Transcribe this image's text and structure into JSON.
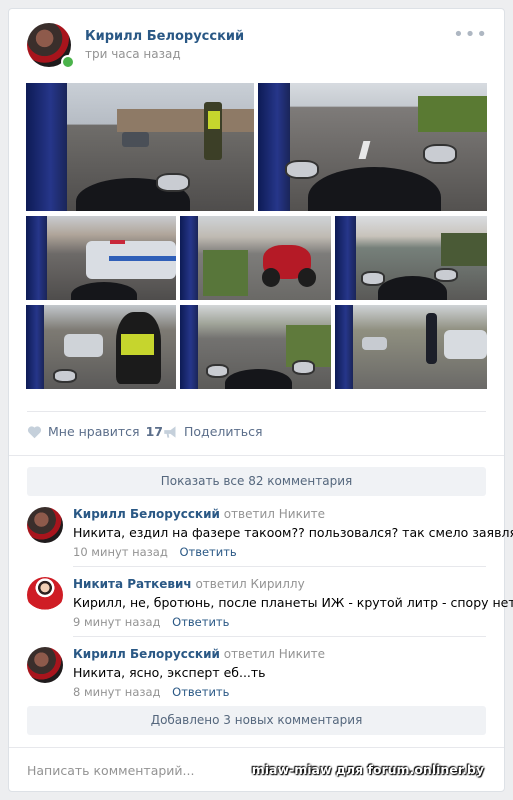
{
  "post": {
    "author": "Кирилл Белорусский",
    "time": "три часа назад",
    "more_icon": "more-horizontal-icon"
  },
  "photos": [
    {
      "alt": "photo-1"
    },
    {
      "alt": "photo-2"
    },
    {
      "alt": "photo-3"
    },
    {
      "alt": "photo-4"
    },
    {
      "alt": "photo-5"
    },
    {
      "alt": "photo-6"
    },
    {
      "alt": "photo-7"
    },
    {
      "alt": "photo-8"
    }
  ],
  "actions": {
    "like_label": "Мне нравится",
    "like_count": "17",
    "share_label": "Поделиться"
  },
  "comments_section": {
    "show_all": "Показать все 82 комментария",
    "new_comments": "Добавлено 3 новых комментария",
    "write_placeholder": "Написать комментарий..."
  },
  "comments": [
    {
      "author": "Кирилл Белорусский",
      "reply_to": "ответил Никите",
      "text": "Никита, ездил на фазере такоом?? пользовался? так смело заявлять",
      "time": "10 минут назад",
      "reply_label": "Ответить"
    },
    {
      "author": "Никита Раткевич",
      "reply_to": "ответил Кириллу",
      "text": "Кирилл, не, бротюнь, после планеты ИЖ - крутой литр - спору нет",
      "time": "9 минут назад",
      "reply_label": "Ответить"
    },
    {
      "author": "Кирилл Белорусский",
      "reply_to": "ответил Никите",
      "text": "Никита, ясно, эксперт еб...ть",
      "time": "8 минут назад",
      "reply_label": "Ответить"
    }
  ],
  "watermark": "miaw-miaw для forum.onliner.by",
  "colors": {
    "link": "#2a5885",
    "meta": "#939393",
    "online": "#4bb34b",
    "background": "#edeef0"
  }
}
